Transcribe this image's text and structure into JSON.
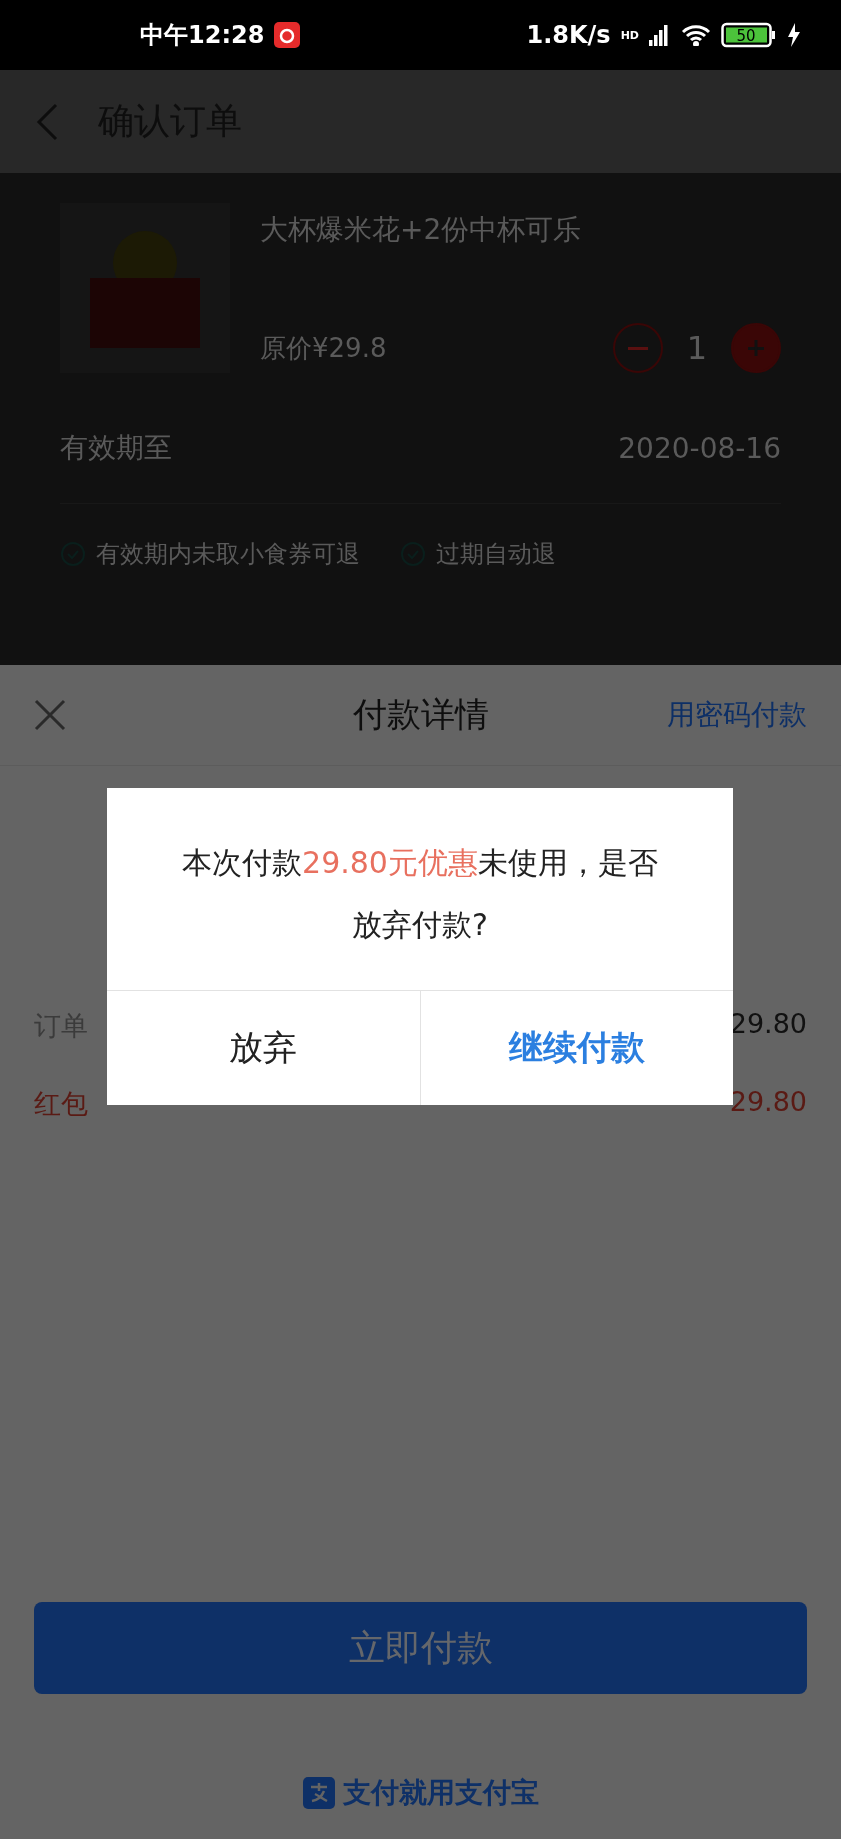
{
  "status_bar": {
    "time": "中午12:28",
    "speed": "1.8K/s",
    "network": "HD",
    "battery": "50"
  },
  "header": {
    "title": "确认订单"
  },
  "product": {
    "name": "大杯爆米花+2份中杯可乐",
    "price": "原价¥29.8",
    "quantity": "1"
  },
  "validity": {
    "label": "有效期至",
    "date": "2020-08-16"
  },
  "policies": [
    {
      "text": "有效期内未取小食券可退",
      "checked": true
    },
    {
      "text": "过期自动退",
      "checked": true
    }
  ],
  "payment_sheet": {
    "title": "付款详情",
    "password_link": "用密码付款",
    "rows": [
      {
        "kind": "normal",
        "label": "订单",
        "value": "29.80"
      },
      {
        "kind": "discount",
        "label": "红包",
        "value": "29.80"
      }
    ],
    "pay_button": "立即付款",
    "footer": "支付就用支付宝"
  },
  "dialog": {
    "message": "本次付款**29.80元优惠**未使用，是否放弃付款?",
    "buttons": [
      {
        "label": "放弃",
        "primary": false
      },
      {
        "label": "继续付款",
        "primary": true
      }
    ]
  }
}
